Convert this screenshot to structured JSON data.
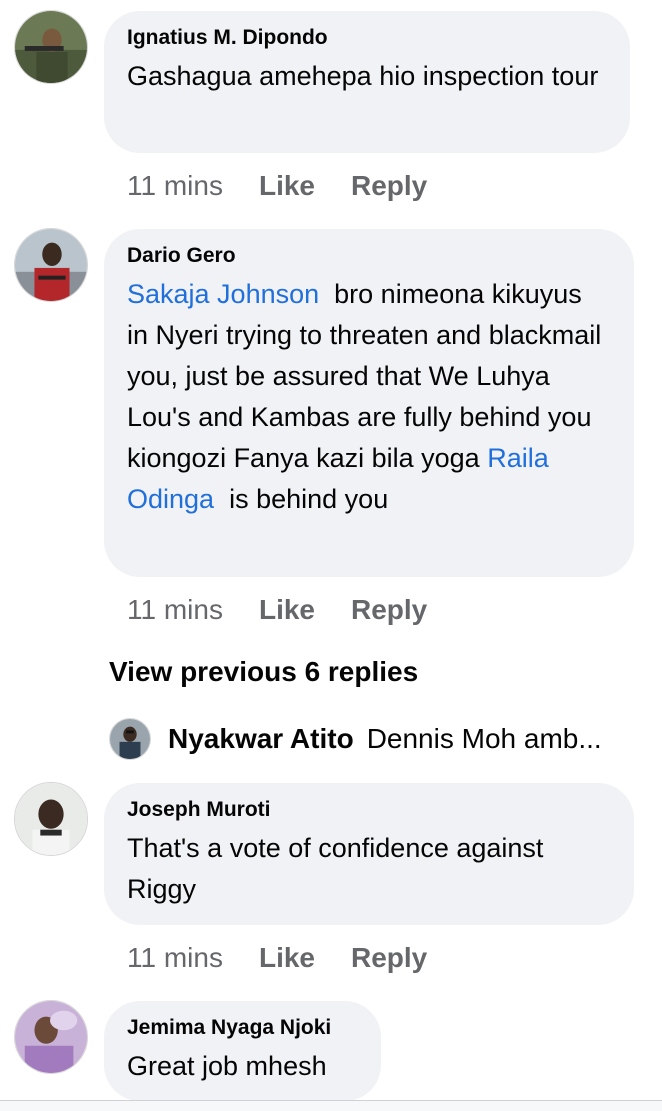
{
  "comments": [
    {
      "author": "Ignatius M. Dipondo",
      "text": "Gashagua amehepa hio inspection tour",
      "time": "11 mins",
      "like": "Like",
      "reply": "Reply"
    },
    {
      "author": "Dario Gero",
      "mention1": "Sakaja Johnson",
      "text_part1": "bro nimeona kikuyus in Nyeri trying to threaten and blackmail you, just be assured that We Luhya Lou's and Kambas are fully behind you kiongozi Fanya kazi bila yoga",
      "mention2": "Raila Odinga",
      "text_part2": "is behind you",
      "time": "11 mins",
      "like": "Like",
      "reply": "Reply"
    },
    {
      "author": "Joseph Muroti",
      "text": "That's a vote of confidence against Riggy",
      "time": "11 mins",
      "like": "Like",
      "reply": "Reply"
    },
    {
      "author": "Jemima Nyaga Njoki",
      "text": "Great job mhesh"
    }
  ],
  "view_previous": "View previous 6 replies",
  "reply_preview": {
    "author": "Nyakwar Atito",
    "text": "Dennis Moh amb..."
  },
  "colors": {
    "bubble": "#f0f2f5",
    "mention": "#216fdb",
    "meta": "#65676b",
    "text": "#050505"
  }
}
